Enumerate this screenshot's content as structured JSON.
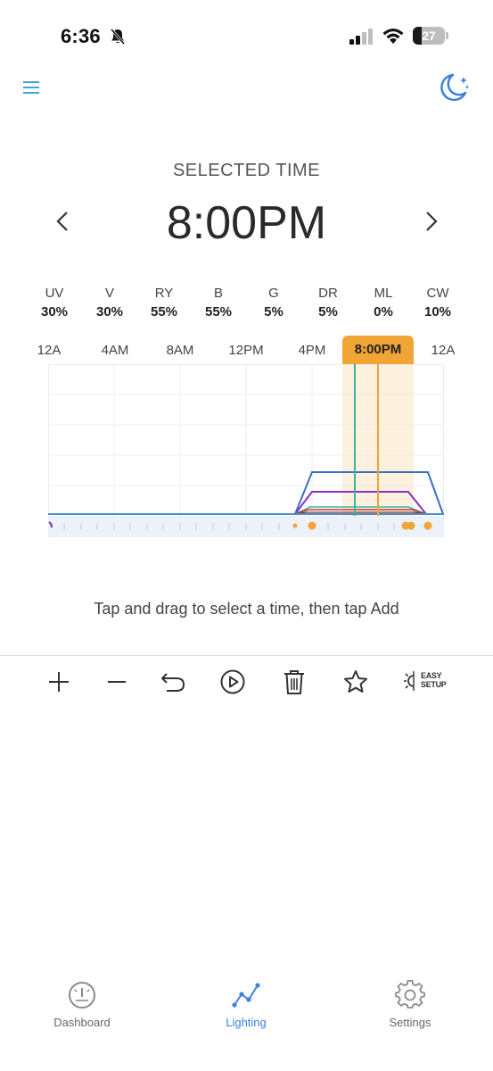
{
  "status_bar": {
    "time": "6:36",
    "battery": "27",
    "battery_level": 0.27
  },
  "header": {
    "selected_time_label": "SELECTED TIME",
    "selected_time": "8:00PM"
  },
  "channels": [
    {
      "name": "UV",
      "value": "30%"
    },
    {
      "name": "V",
      "value": "30%"
    },
    {
      "name": "RY",
      "value": "55%"
    },
    {
      "name": "B",
      "value": "55%"
    },
    {
      "name": "G",
      "value": "5%"
    },
    {
      "name": "DR",
      "value": "5%"
    },
    {
      "name": "ML",
      "value": "0%"
    },
    {
      "name": "CW",
      "value": "10%"
    }
  ],
  "time_axis": {
    "labels": [
      "12A",
      "4AM",
      "8AM",
      "12PM",
      "4PM",
      "8:00PM",
      "12A"
    ],
    "selected_label": "8:00PM"
  },
  "hint": "Tap and drag to select a time, then tap Add",
  "toolbar": {
    "easy_setup_line1": "EASY",
    "easy_setup_line2": "SETUP"
  },
  "nav": {
    "dashboard": "Dashboard",
    "lighting": "Lighting",
    "settings": "Settings"
  },
  "colors": {
    "accent": "#3d82dc",
    "selection": "#f0a535",
    "teal": "#3fb2a4"
  }
}
